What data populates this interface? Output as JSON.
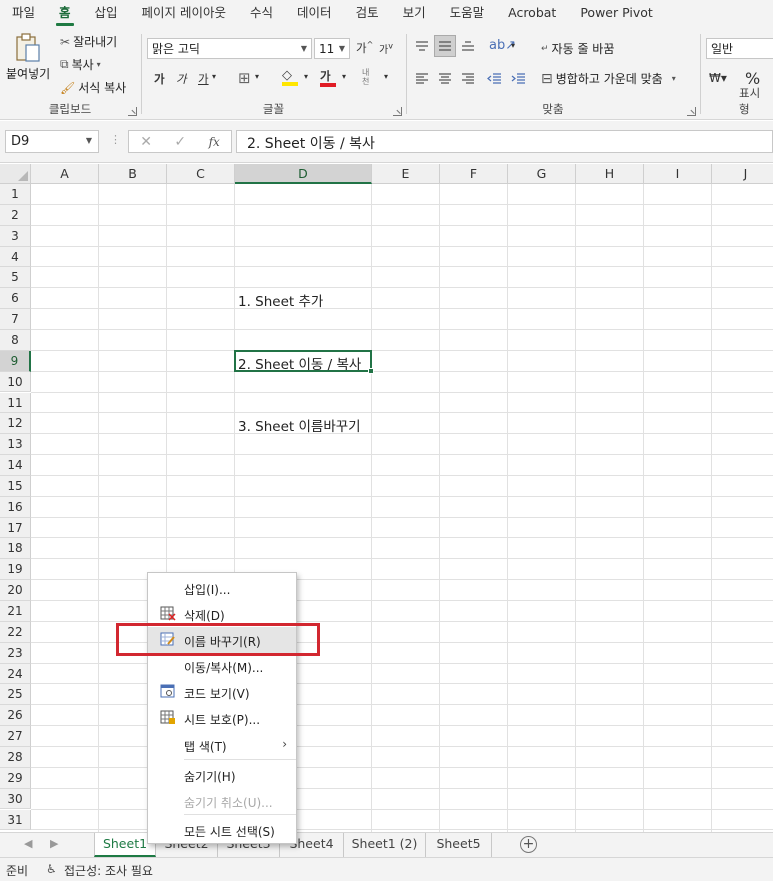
{
  "ribbon_tabs": [
    "파일",
    "홈",
    "삽입",
    "페이지 레이아웃",
    "수식",
    "데이터",
    "검토",
    "보기",
    "도움말",
    "Acrobat",
    "Power Pivot"
  ],
  "ribbon": {
    "clipboard": {
      "paste": "붙여넣기",
      "cut": "잘라내기",
      "copy": "복사",
      "format_painter": "서식 복사",
      "label": "클립보드"
    },
    "font": {
      "name": "맑은 고딕",
      "size": "11",
      "grow": "가",
      "shrink": "가",
      "bold": "가",
      "italic": "가",
      "underline": "가",
      "phonetic": "내천",
      "label": "글꼴"
    },
    "alignment": {
      "wrap_text": "자동 줄 바꿈",
      "merge_center": "병합하고 가운데 맞춤",
      "label": "맞춤"
    },
    "number": {
      "format": "일반",
      "percent": "%",
      "label": "표시 형"
    }
  },
  "formula_bar": {
    "name_box": "D9",
    "fx": "fx",
    "formula": "2. Sheet 이동 / 복사"
  },
  "columns": [
    "A",
    "B",
    "C",
    "D",
    "E",
    "F",
    "G",
    "H",
    "I",
    "J"
  ],
  "selected_column": "D",
  "rows": [
    "1",
    "2",
    "3",
    "4",
    "5",
    "6",
    "7",
    "8",
    "9",
    "10",
    "11",
    "12",
    "13",
    "14",
    "15",
    "16",
    "17",
    "18",
    "19",
    "20",
    "21",
    "22",
    "23",
    "24",
    "25",
    "26",
    "27",
    "28",
    "29",
    "30",
    "31"
  ],
  "selected_row": "9",
  "cells": {
    "D6": "1. Sheet 추가",
    "D9": "2. Sheet 이동 / 복사",
    "D12": "3. Sheet 이름바꾸기"
  },
  "sheet_tabs": [
    "Sheet1",
    "Sheet2",
    "Sheet3",
    "Sheet4",
    "Sheet1 (2)",
    "Sheet5"
  ],
  "active_sheet": "Sheet1",
  "status": {
    "ready": "준비",
    "accessibility": "접근성: 조사 필요"
  },
  "context_menu": [
    {
      "label": "삽입(I)...",
      "icon": "",
      "state": "normal"
    },
    {
      "label": "삭제(D)",
      "icon": "delete-sheet-icon",
      "state": "normal"
    },
    {
      "label": "이름 바꾸기(R)",
      "icon": "rename-sheet-icon",
      "state": "highlighted"
    },
    {
      "label": "이동/복사(M)...",
      "icon": "",
      "state": "normal"
    },
    {
      "label": "코드 보기(V)",
      "icon": "view-code-icon",
      "state": "normal"
    },
    {
      "label": "시트 보호(P)...",
      "icon": "protect-sheet-icon",
      "state": "normal"
    },
    {
      "label": "탭 색(T)",
      "icon": "",
      "state": "normal",
      "submenu": true
    },
    {
      "label": "숨기기(H)",
      "icon": "",
      "state": "normal"
    },
    {
      "label": "숨기기 취소(U)...",
      "icon": "",
      "state": "disabled"
    },
    {
      "label": "모든 시트 선택(S)",
      "icon": "",
      "state": "normal"
    }
  ],
  "colors": {
    "accent": "#217346",
    "highlight_box": "#d22730"
  }
}
